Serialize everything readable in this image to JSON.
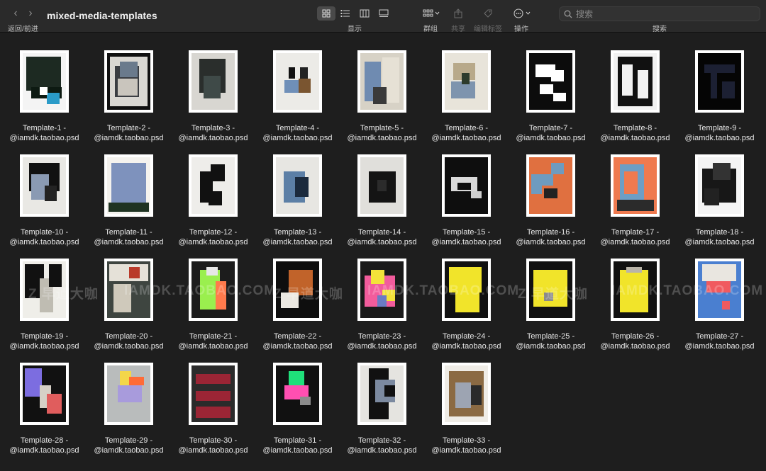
{
  "window": {
    "title": "mixed-media-templates"
  },
  "toolbar": {
    "nav_caption": "返回/前进",
    "view_caption": "显示",
    "group_caption": "群组",
    "share_caption": "共享",
    "tags_caption": "编辑标签",
    "action_caption": "操作",
    "search_caption": "搜索",
    "search_placeholder": "搜索"
  },
  "files": [
    {
      "line1": "Template-1 -",
      "line2": "@iamdk.taobao.psd",
      "bg": "#f4f4f4",
      "shapes": [
        [
          "#1d2a22",
          8,
          6,
          80,
          60
        ],
        [
          "#0d1a12",
          20,
          60,
          70,
          20
        ],
        [
          "#2a9bc8",
          55,
          70,
          30,
          20
        ],
        [
          "#ffffff",
          40,
          60,
          18,
          14
        ]
      ]
    },
    {
      "line1": "Template-2 -",
      "line2": "@iamdk.taobao.psd",
      "bg": "#101010",
      "shapes": [
        [
          "#d9d7d2",
          6,
          6,
          88,
          88
        ],
        [
          "#3a3d42",
          18,
          22,
          55,
          55
        ],
        [
          "#6a7a8c",
          30,
          15,
          40,
          28
        ],
        [
          "#c9c5bd",
          25,
          45,
          45,
          30
        ]
      ]
    },
    {
      "line1": "Template-3 -",
      "line2": "@iamdk.taobao.psd",
      "bg": "#d8d6d1",
      "shapes": [
        [
          "#2a2e2c",
          18,
          10,
          60,
          60
        ],
        [
          "#3f4a48",
          28,
          40,
          40,
          40
        ]
      ]
    },
    {
      "line1": "Template-4 -",
      "line2": "@iamdk.taobao.psd",
      "bg": "#ecebe7",
      "shapes": [
        [
          "#111",
          30,
          25,
          15,
          20
        ],
        [
          "#6f8fb8",
          20,
          48,
          32,
          22
        ],
        [
          "#7a5530",
          52,
          45,
          28,
          25
        ],
        [
          "#222",
          55,
          25,
          18,
          20
        ]
      ]
    },
    {
      "line1": "Template-5 -",
      "line2": "@iamdk.taobao.psd",
      "bg": "#d7d2c6",
      "shapes": [
        [
          "#6f8bb1",
          10,
          15,
          38,
          70
        ],
        [
          "#e6e1d5",
          50,
          8,
          40,
          80
        ],
        [
          "#3a3a3a",
          30,
          60,
          30,
          30
        ]
      ]
    },
    {
      "line1": "Template-6 -",
      "line2": "@iamdk.taobao.psd",
      "bg": "#e8e4da",
      "shapes": [
        [
          "#b8a98a",
          20,
          18,
          50,
          30
        ],
        [
          "#7e94ae",
          15,
          50,
          55,
          30
        ],
        [
          "#2d3b2c",
          40,
          35,
          18,
          20
        ]
      ]
    },
    {
      "line1": "Template-7 -",
      "line2": "@iamdk.taobao.psd",
      "bg": "#0c0c0c",
      "shapes": [
        [
          "#fff",
          15,
          20,
          45,
          22
        ],
        [
          "#fff",
          50,
          30,
          30,
          20
        ],
        [
          "#fff",
          25,
          55,
          30,
          18
        ],
        [
          "#fff",
          55,
          70,
          30,
          15
        ]
      ]
    },
    {
      "line1": "Template-8 -",
      "line2": "@iamdk.taobao.psd",
      "bg": "#f2f2f2",
      "shapes": [
        [
          "#111",
          10,
          6,
          80,
          88
        ],
        [
          "#f2f2f2",
          20,
          20,
          25,
          55
        ],
        [
          "#f2f2f2",
          55,
          30,
          25,
          50
        ]
      ]
    },
    {
      "line1": "Template-9 -",
      "line2": "@iamdk.taobao.psd",
      "bg": "#050505",
      "shapes": [
        [
          "#1c2033",
          15,
          20,
          70,
          15
        ],
        [
          "#1c2033",
          30,
          35,
          15,
          45
        ],
        [
          "#1c2033",
          55,
          50,
          30,
          30
        ]
      ]
    },
    {
      "line1": "Template-10 -",
      "line2": "@iamdk.taobao.psd",
      "bg": "#e9e8e4",
      "shapes": [
        [
          "#111",
          15,
          10,
          70,
          50
        ],
        [
          "#8a9ab3",
          20,
          30,
          40,
          45
        ],
        [
          "#232323",
          50,
          50,
          28,
          28
        ]
      ]
    },
    {
      "line1": "Template-11 -",
      "line2": "@iamdk.taobao.psd",
      "bg": "#f4f2ee",
      "shapes": [
        [
          "#1f3322",
          4,
          80,
          92,
          16
        ],
        [
          "#7e92bd",
          10,
          10,
          80,
          70
        ]
      ]
    },
    {
      "line1": "Template-12 -",
      "line2": "@iamdk.taobao.psd",
      "bg": "#eeedea",
      "shapes": [
        [
          "#111",
          20,
          25,
          30,
          55
        ],
        [
          "#111",
          45,
          12,
          32,
          30
        ],
        [
          "#111",
          40,
          60,
          30,
          25
        ]
      ]
    },
    {
      "line1": "Template-13 -",
      "line2": "@iamdk.taobao.psd",
      "bg": "#e7e6e2",
      "shapes": [
        [
          "#5c7fa6",
          18,
          25,
          50,
          55
        ],
        [
          "#1b2a3d",
          45,
          35,
          30,
          35
        ]
      ]
    },
    {
      "line1": "Template-14 -",
      "line2": "@iamdk.taobao.psd",
      "bg": "#e0dfdb",
      "shapes": [
        [
          "#141414",
          20,
          25,
          62,
          55
        ],
        [
          "#2b2b2b",
          40,
          40,
          20,
          20
        ]
      ]
    },
    {
      "line1": "Template-15 -",
      "line2": "@iamdk.taobao.psd",
      "bg": "#0e0e0e",
      "shapes": [
        [
          "#d9d9d9",
          15,
          35,
          60,
          25
        ],
        [
          "#0e0e0e",
          30,
          45,
          30,
          12
        ],
        [
          "#cfcfcf",
          60,
          60,
          25,
          12
        ]
      ]
    },
    {
      "line1": "Template-16 -",
      "line2": "@iamdk.taobao.psd",
      "bg": "#e07040",
      "shapes": [
        [
          "#6e9bbf",
          5,
          30,
          50,
          35
        ],
        [
          "#e07040",
          30,
          50,
          40,
          25
        ],
        [
          "#222",
          35,
          55,
          30,
          18
        ],
        [
          "#6e9bbf",
          50,
          10,
          30,
          20
        ]
      ]
    },
    {
      "line1": "Template-17 -",
      "line2": "@iamdk.taobao.psd",
      "bg": "#ef7a4f",
      "shapes": [
        [
          "#6d9ec5",
          15,
          12,
          55,
          65
        ],
        [
          "#ef7a4f",
          25,
          25,
          30,
          40
        ],
        [
          "#2b2b2b",
          8,
          75,
          85,
          20
        ]
      ]
    },
    {
      "line1": "Template-18 -",
      "line2": "@iamdk.taobao.psd",
      "bg": "#f4f4f4",
      "shapes": [
        [
          "#171717",
          10,
          20,
          78,
          60
        ],
        [
          "#333",
          35,
          10,
          40,
          30
        ],
        [
          "#222",
          15,
          55,
          35,
          30
        ]
      ]
    },
    {
      "line1": "Template-19 -",
      "line2": "@iamdk.taobao.psd",
      "bg": "#efeee9",
      "shapes": [
        [
          "#111",
          5,
          5,
          45,
          60
        ],
        [
          "#bfbcb2",
          40,
          30,
          30,
          60
        ],
        [
          "#111",
          60,
          5,
          30,
          40
        ]
      ]
    },
    {
      "line1": "Template-20 -",
      "line2": "@iamdk.taobao.psd",
      "bg": "#3e4540",
      "shapes": [
        [
          "#e5e1d8",
          5,
          5,
          90,
          30
        ],
        [
          "#b93a2a",
          50,
          10,
          25,
          20
        ],
        [
          "#cfc9bb",
          15,
          40,
          40,
          50
        ]
      ]
    },
    {
      "line1": "Template-21 -",
      "line2": "@iamdk.taobao.psd",
      "bg": "#1c1c1c",
      "shapes": [
        [
          "#9aef4e",
          20,
          15,
          45,
          70
        ],
        [
          "#ff7a4c",
          55,
          35,
          25,
          50
        ],
        [
          "#e7e7e7",
          35,
          10,
          25,
          15
        ]
      ]
    },
    {
      "line1": "Template-22 -",
      "line2": "@iamdk.taobao.psd",
      "bg": "#0e0e0e",
      "shapes": [
        [
          "#c1632a",
          30,
          15,
          55,
          45
        ],
        [
          "#ece9e2",
          12,
          55,
          40,
          28
        ]
      ]
    },
    {
      "line1": "Template-23 -",
      "line2": "@iamdk.taobao.psd",
      "bg": "#1a1a1a",
      "shapes": [
        [
          "#f25c9c",
          10,
          25,
          70,
          55
        ],
        [
          "#f3e23a",
          25,
          15,
          30,
          25
        ],
        [
          "#f3e23a",
          50,
          50,
          30,
          20
        ],
        [
          "#6b7cc4",
          40,
          60,
          20,
          20
        ]
      ]
    },
    {
      "line1": "Template-24 -",
      "line2": "@iamdk.taobao.psd",
      "bg": "#111",
      "shapes": [
        [
          "#f1e42a",
          10,
          10,
          75,
          45
        ],
        [
          "#f1e42a",
          25,
          50,
          55,
          40
        ]
      ]
    },
    {
      "line1": "Template-25 -",
      "line2": "@iamdk.taobao.psd",
      "bg": "#111",
      "shapes": [
        [
          "#f1e42a",
          10,
          15,
          78,
          65
        ],
        [
          "#8a8a8a",
          35,
          55,
          20,
          15
        ]
      ]
    },
    {
      "line1": "Template-26 -",
      "line2": "@iamdk.taobao.psd",
      "bg": "#111",
      "shapes": [
        [
          "#f1e42a",
          15,
          15,
          65,
          75
        ],
        [
          "#b9b4a8",
          30,
          10,
          35,
          10
        ]
      ]
    },
    {
      "line1": "Template-27 -",
      "line2": "@iamdk.taobao.psd",
      "bg": "#4a7fd0",
      "shapes": [
        [
          "#e9e6e0",
          10,
          5,
          78,
          30
        ],
        [
          "#f05a5f",
          20,
          35,
          55,
          20
        ],
        [
          "#f05a5f",
          55,
          70,
          18,
          15
        ]
      ]
    },
    {
      "line1": "Template-28 -",
      "line2": "@iamdk.taobao.psd",
      "bg": "#111",
      "shapes": [
        [
          "#7c6de0",
          5,
          5,
          40,
          50
        ],
        [
          "#d6d0c6",
          40,
          35,
          25,
          40
        ],
        [
          "#e05d5d",
          55,
          50,
          35,
          35
        ]
      ]
    },
    {
      "line1": "Template-29 -",
      "line2": "@iamdk.taobao.psd",
      "bg": "#b9bcbc",
      "shapes": [
        [
          "#f3d64a",
          30,
          10,
          25,
          25
        ],
        [
          "#ff6b37",
          50,
          20,
          35,
          15
        ],
        [
          "#a89bdc",
          25,
          35,
          55,
          30
        ]
      ]
    },
    {
      "line1": "Template-30 -",
      "line2": "@iamdk.taobao.psd",
      "bg": "#2b2b2b",
      "shapes": [
        [
          "#9b2535",
          10,
          15,
          80,
          18
        ],
        [
          "#9b2535",
          10,
          45,
          80,
          18
        ],
        [
          "#9b2535",
          10,
          72,
          80,
          20
        ]
      ]
    },
    {
      "line1": "Template-31 -",
      "line2": "@iamdk.taobao.psd",
      "bg": "#111",
      "shapes": [
        [
          "#1fe07a",
          30,
          10,
          35,
          25
        ],
        [
          "#ff4fb1",
          20,
          35,
          55,
          25
        ],
        [
          "#8c8c8c",
          55,
          55,
          25,
          15
        ]
      ]
    },
    {
      "line1": "Template-32 -",
      "line2": "@iamdk.taobao.psd",
      "bg": "#e5e4e0",
      "shapes": [
        [
          "#111",
          20,
          5,
          45,
          90
        ],
        [
          "#7c8aa0",
          35,
          25,
          45,
          40
        ],
        [
          "#111",
          55,
          35,
          25,
          20
        ]
      ]
    },
    {
      "line1": "Template-33 -",
      "line2": "@iamdk.taobao.psd",
      "bg": "#efece6",
      "shapes": [
        [
          "#8b6a43",
          10,
          10,
          80,
          80
        ],
        [
          "#9da4b2",
          25,
          30,
          35,
          45
        ],
        [
          "#2a2a2a",
          60,
          35,
          25,
          35
        ]
      ]
    }
  ],
  "watermark": {
    "a": "Z 早道大咖",
    "b": "IAMDK.TAOBAO.COM"
  }
}
